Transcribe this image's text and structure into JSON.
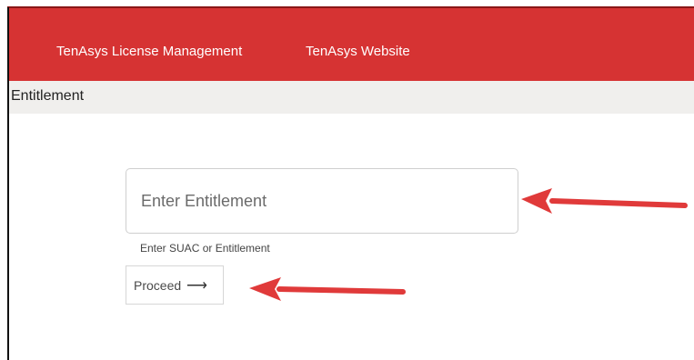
{
  "navbar": {
    "links": [
      {
        "label": "TenAsys License Management"
      },
      {
        "label": "TenAsys Website"
      }
    ]
  },
  "page": {
    "title": "Entitlement"
  },
  "form": {
    "input_placeholder": "Enter Entitlement",
    "input_value": "",
    "helper_text": "Enter SUAC or Entitlement",
    "proceed_label": "Proceed",
    "proceed_icon": "arrow-right-icon"
  },
  "colors": {
    "navbar": "#d63333",
    "subbar": "#f0efed",
    "annotation_arrow": "#e03a3a"
  }
}
